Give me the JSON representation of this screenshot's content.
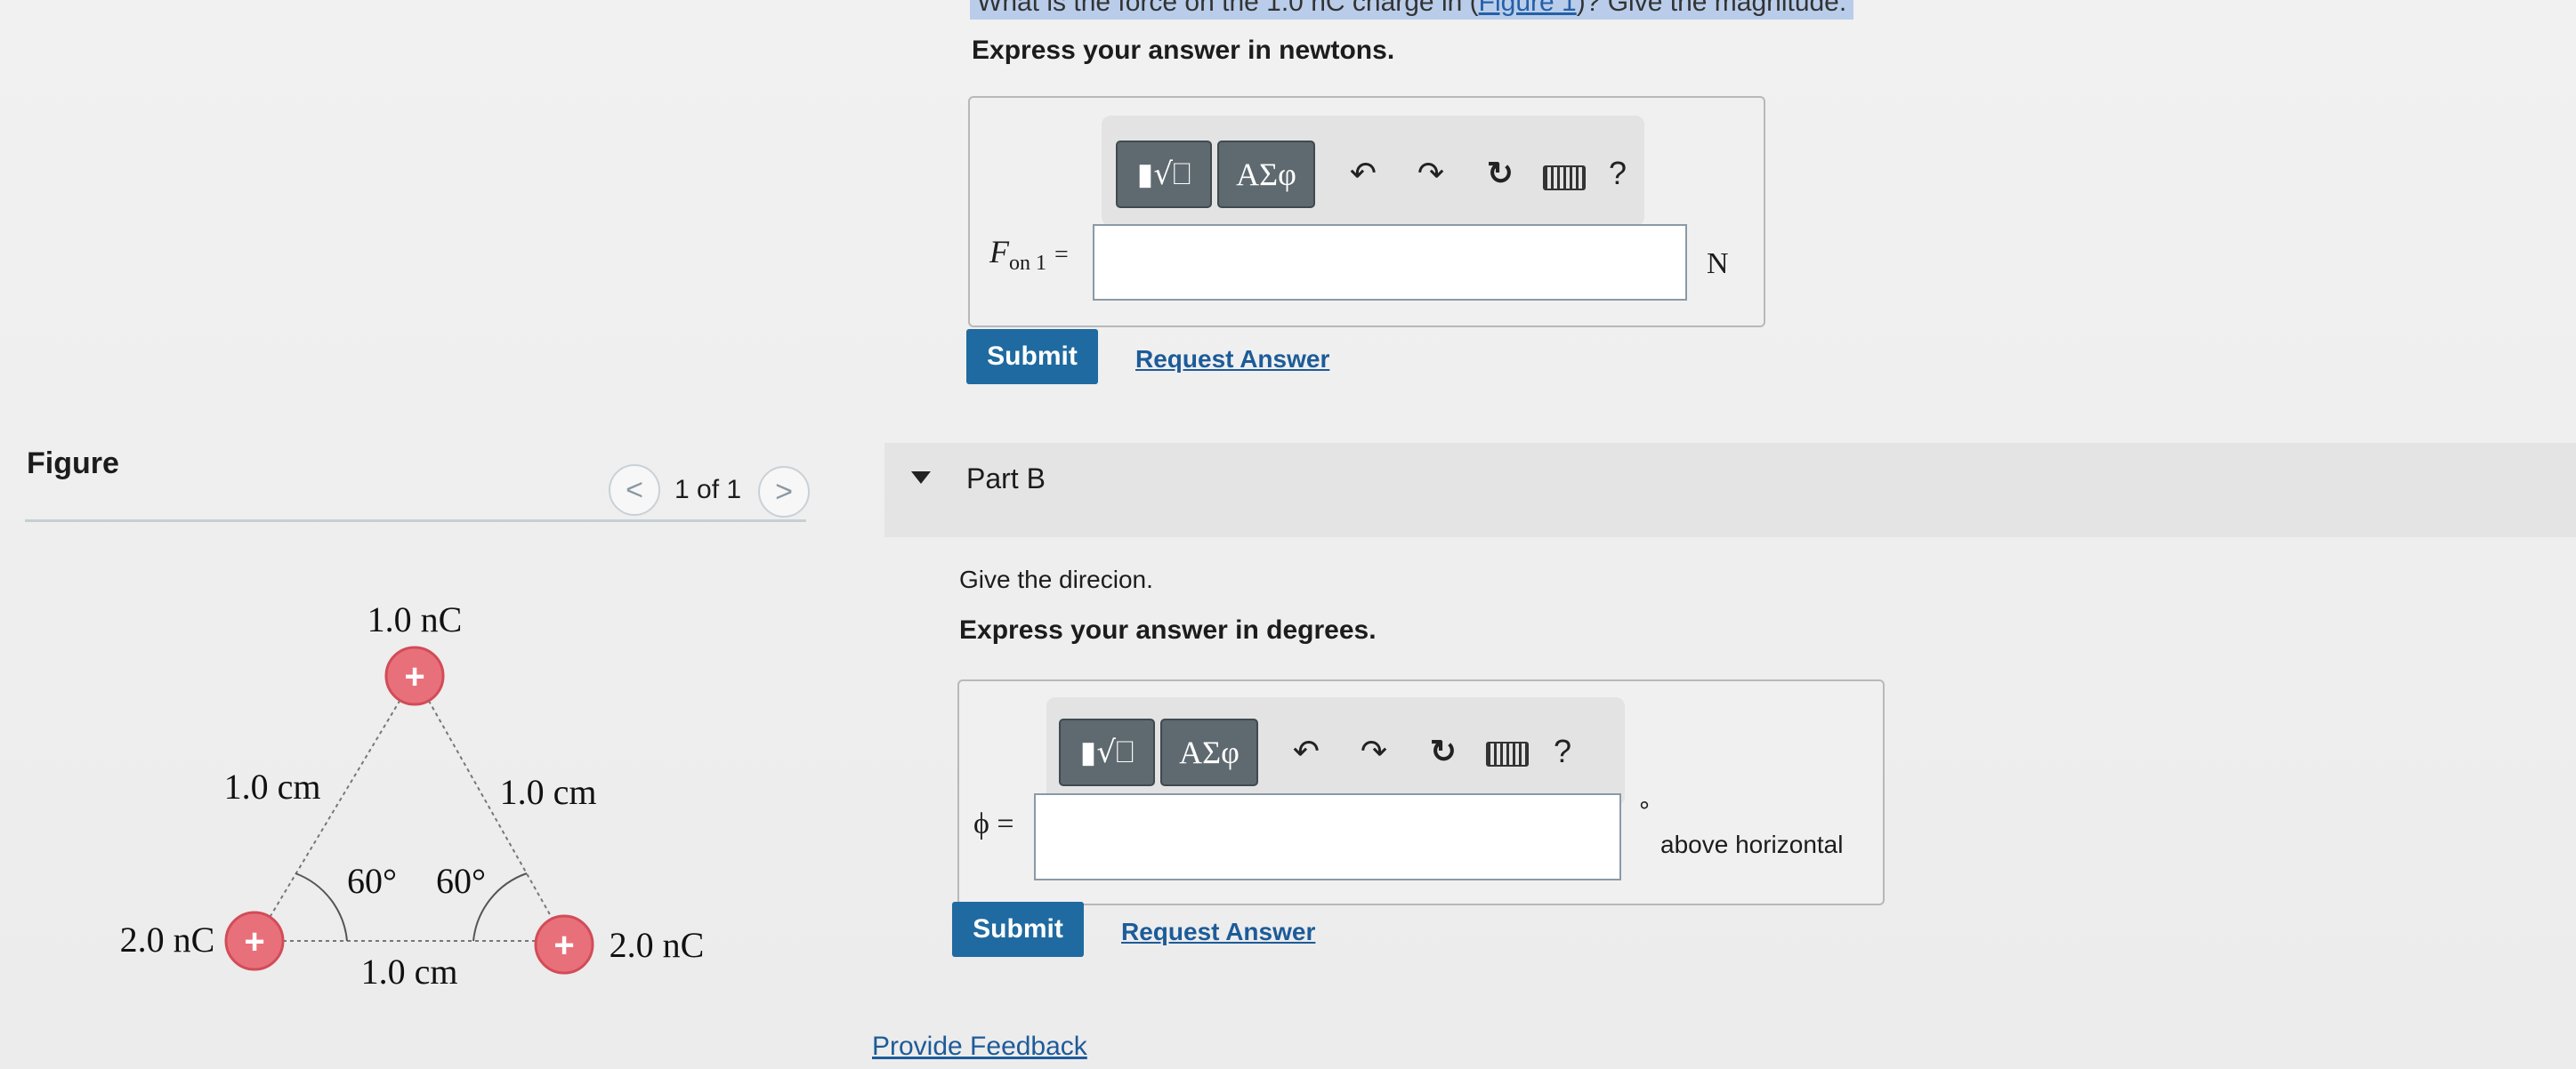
{
  "question_partial": {
    "text_before": "What is the force on the 1.0 nC charge in (",
    "link": "Figure 1",
    "text_after": ")? Give the magnitude."
  },
  "partA": {
    "instruction": "Express your answer in newtons.",
    "label_var": "F",
    "label_sub": "on 1",
    "label_eq": "=",
    "units": "N",
    "submit": "Submit",
    "request": "Request Answer"
  },
  "toolbar": {
    "template_icon": "template-radical-icon",
    "greek": "ΑΣφ",
    "undo": "↶",
    "redo": "↷",
    "reset": "↻",
    "keyboard_icon": "keyboard-icon",
    "help": "?"
  },
  "figure": {
    "title": "Figure",
    "page": "1 of 1",
    "prev": "<",
    "next": ">",
    "top_charge": "1.0 nC",
    "left_charge": "2.0 nC",
    "right_charge": "2.0 nC",
    "plus": "+",
    "left_side": "1.0 cm",
    "right_side": "1.0 cm",
    "bottom_side": "1.0 cm",
    "angle_left": "60°",
    "angle_right": "60°"
  },
  "partB": {
    "title": "Part B",
    "prompt": "Give the direcion.",
    "instruction": "Express your answer in degrees.",
    "label": "ϕ =",
    "units_deg": "°",
    "units_text": "above horizontal",
    "submit": "Submit",
    "request": "Request Answer"
  },
  "feedback": "Provide Feedback",
  "colors": {
    "accent": "#1f6aa0",
    "charge_fill": "#e8707a",
    "link": "#1d5b99"
  }
}
